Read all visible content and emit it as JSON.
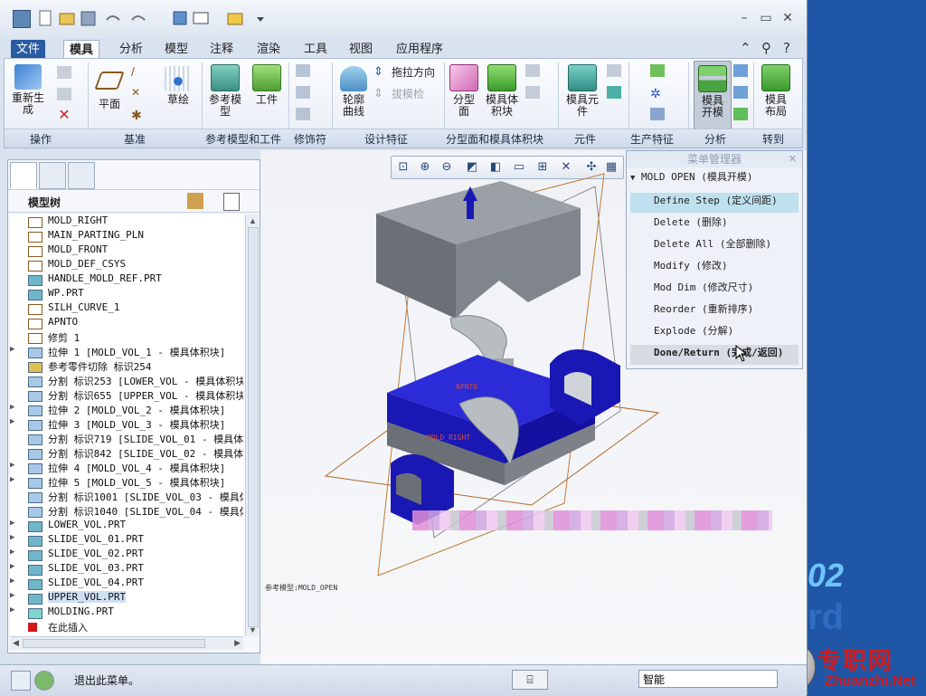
{
  "tabs": {
    "file": "文件",
    "items": [
      "模具",
      "分析",
      "模型",
      "注释",
      "渲染",
      "工具",
      "视图",
      "应用程序"
    ]
  },
  "ribbon": {
    "groups": [
      "操作",
      "基准",
      "参考模型和工件",
      "修饰符",
      "设计特征",
      "分型面和模具体积块",
      "元件",
      "生产特征",
      "分析",
      "转到"
    ],
    "buttons": {
      "regenerate": "重新生\n成",
      "plane": "平面",
      "sketch": "草绘",
      "ref_model": "参考模\n型",
      "workpiece": "工件",
      "silhouette": "轮廓\n曲线",
      "draft_direction": "拖拉方向",
      "draft_check": "拔模检",
      "parting_surface": "分型\n面",
      "mold_volume": "模具体\n积块",
      "mold_component": "模具元\n件",
      "mold_open": "模具\n开模",
      "mold_layout": "模具\n布局"
    }
  },
  "model_tree": {
    "title": "模型树",
    "items": [
      {
        "label": "MOLD_RIGHT",
        "expand": false,
        "icon": "datum-plane-icon"
      },
      {
        "label": "MAIN_PARTING_PLN",
        "expand": false,
        "icon": "datum-plane-icon"
      },
      {
        "label": "MOLD_FRONT",
        "expand": false,
        "icon": "datum-plane-icon"
      },
      {
        "label": "MOLD_DEF_CSYS",
        "expand": false,
        "icon": "csys-icon"
      },
      {
        "label": "HANDLE_MOLD_REF.PRT",
        "expand": false,
        "icon": "part-icon"
      },
      {
        "label": "WP.PRT",
        "expand": false,
        "icon": "part-icon"
      },
      {
        "label": "SILH_CURVE_1",
        "expand": false,
        "icon": "curve-icon"
      },
      {
        "label": "APNTO",
        "expand": false,
        "icon": "point-icon"
      },
      {
        "label": "修剪 1",
        "expand": false,
        "icon": "curve-icon"
      },
      {
        "label": "拉伸 1 [MOLD_VOL_1 - 模具体积块]",
        "expand": true,
        "icon": "volume-icon"
      },
      {
        "label": "参考零件切除 标识254",
        "expand": false,
        "icon": "cut-icon"
      },
      {
        "label": "分割 标识253 [LOWER_VOL - 模具体积块",
        "expand": false,
        "icon": "volume-icon"
      },
      {
        "label": "分割 标识655 [UPPER_VOL - 模具体积块",
        "expand": false,
        "icon": "volume-icon"
      },
      {
        "label": "拉伸 2 [MOLD_VOL_2 - 模具体积块]",
        "expand": true,
        "icon": "volume-icon"
      },
      {
        "label": "拉伸 3 [MOLD_VOL_3 - 模具体积块]",
        "expand": true,
        "icon": "volume-icon"
      },
      {
        "label": "分割 标识719 [SLIDE_VOL_01 - 模具体",
        "expand": false,
        "icon": "volume-icon"
      },
      {
        "label": "分割 标识842 [SLIDE_VOL_02 - 模具体",
        "expand": false,
        "icon": "volume-icon"
      },
      {
        "label": "拉伸 4 [MOLD_VOL_4 - 模具体积块]",
        "expand": true,
        "icon": "volume-icon"
      },
      {
        "label": "拉伸 5 [MOLD_VOL_5 - 模具体积块]",
        "expand": true,
        "icon": "volume-icon"
      },
      {
        "label": "分割 标识1001 [SLIDE_VOL_03 - 模具体",
        "expand": false,
        "icon": "volume-icon"
      },
      {
        "label": "分割 标识1040 [SLIDE_VOL_04 - 模具体",
        "expand": false,
        "icon": "volume-icon"
      },
      {
        "label": "LOWER_VOL.PRT",
        "expand": true,
        "icon": "part-icon"
      },
      {
        "label": "SLIDE_VOL_01.PRT",
        "expand": true,
        "icon": "part-icon"
      },
      {
        "label": "SLIDE_VOL_02.PRT",
        "expand": true,
        "icon": "part-icon"
      },
      {
        "label": "SLIDE_VOL_03.PRT",
        "expand": true,
        "icon": "part-icon"
      },
      {
        "label": "SLIDE_VOL_04.PRT",
        "expand": true,
        "icon": "part-icon"
      },
      {
        "label": "UPPER_VOL.PRT",
        "expand": true,
        "icon": "part-icon",
        "selected": true
      },
      {
        "label": "MOLDING.PRT",
        "expand": true,
        "icon": "molding-icon"
      },
      {
        "label": "在此插入",
        "expand": false,
        "icon": "insert-arrow-icon"
      }
    ]
  },
  "graphics": {
    "model_label": "参考模型:MOLD_OPEN",
    "label_apnto": "APNTO",
    "label_mold_right": "MOLD_RIGHT"
  },
  "menu_manager": {
    "title": "菜单管理器",
    "submenu": "MOLD OPEN (模具开模)",
    "items": [
      {
        "label": "Define Step (定义间距)",
        "state": "highlight"
      },
      {
        "label": "Delete (删除)",
        "state": "normal"
      },
      {
        "label": "Delete All (全部删除)",
        "state": "normal"
      },
      {
        "label": "Modify (修改)",
        "state": "normal"
      },
      {
        "label": "Mod Dim (修改尺寸)",
        "state": "normal"
      },
      {
        "label": "Reorder (重新排序)",
        "state": "normal"
      },
      {
        "label": "Explode (分解)",
        "state": "normal"
      },
      {
        "label": "Done/Return (完成/返回)",
        "state": "done"
      }
    ]
  },
  "status": {
    "message": "退出此菜单。",
    "filter": "智能"
  },
  "desktop": {
    "logo_text": "02",
    "logo_text2": "rd"
  },
  "watermark": {
    "cn": "专职网",
    "en": "Zhuanzhi.Net"
  },
  "colors": {
    "accent_blue": "#2a5aa0",
    "mold_blue": "#1a18b5",
    "gray_block": "#7d8288",
    "menu_highlight": "#bfe0ee"
  }
}
